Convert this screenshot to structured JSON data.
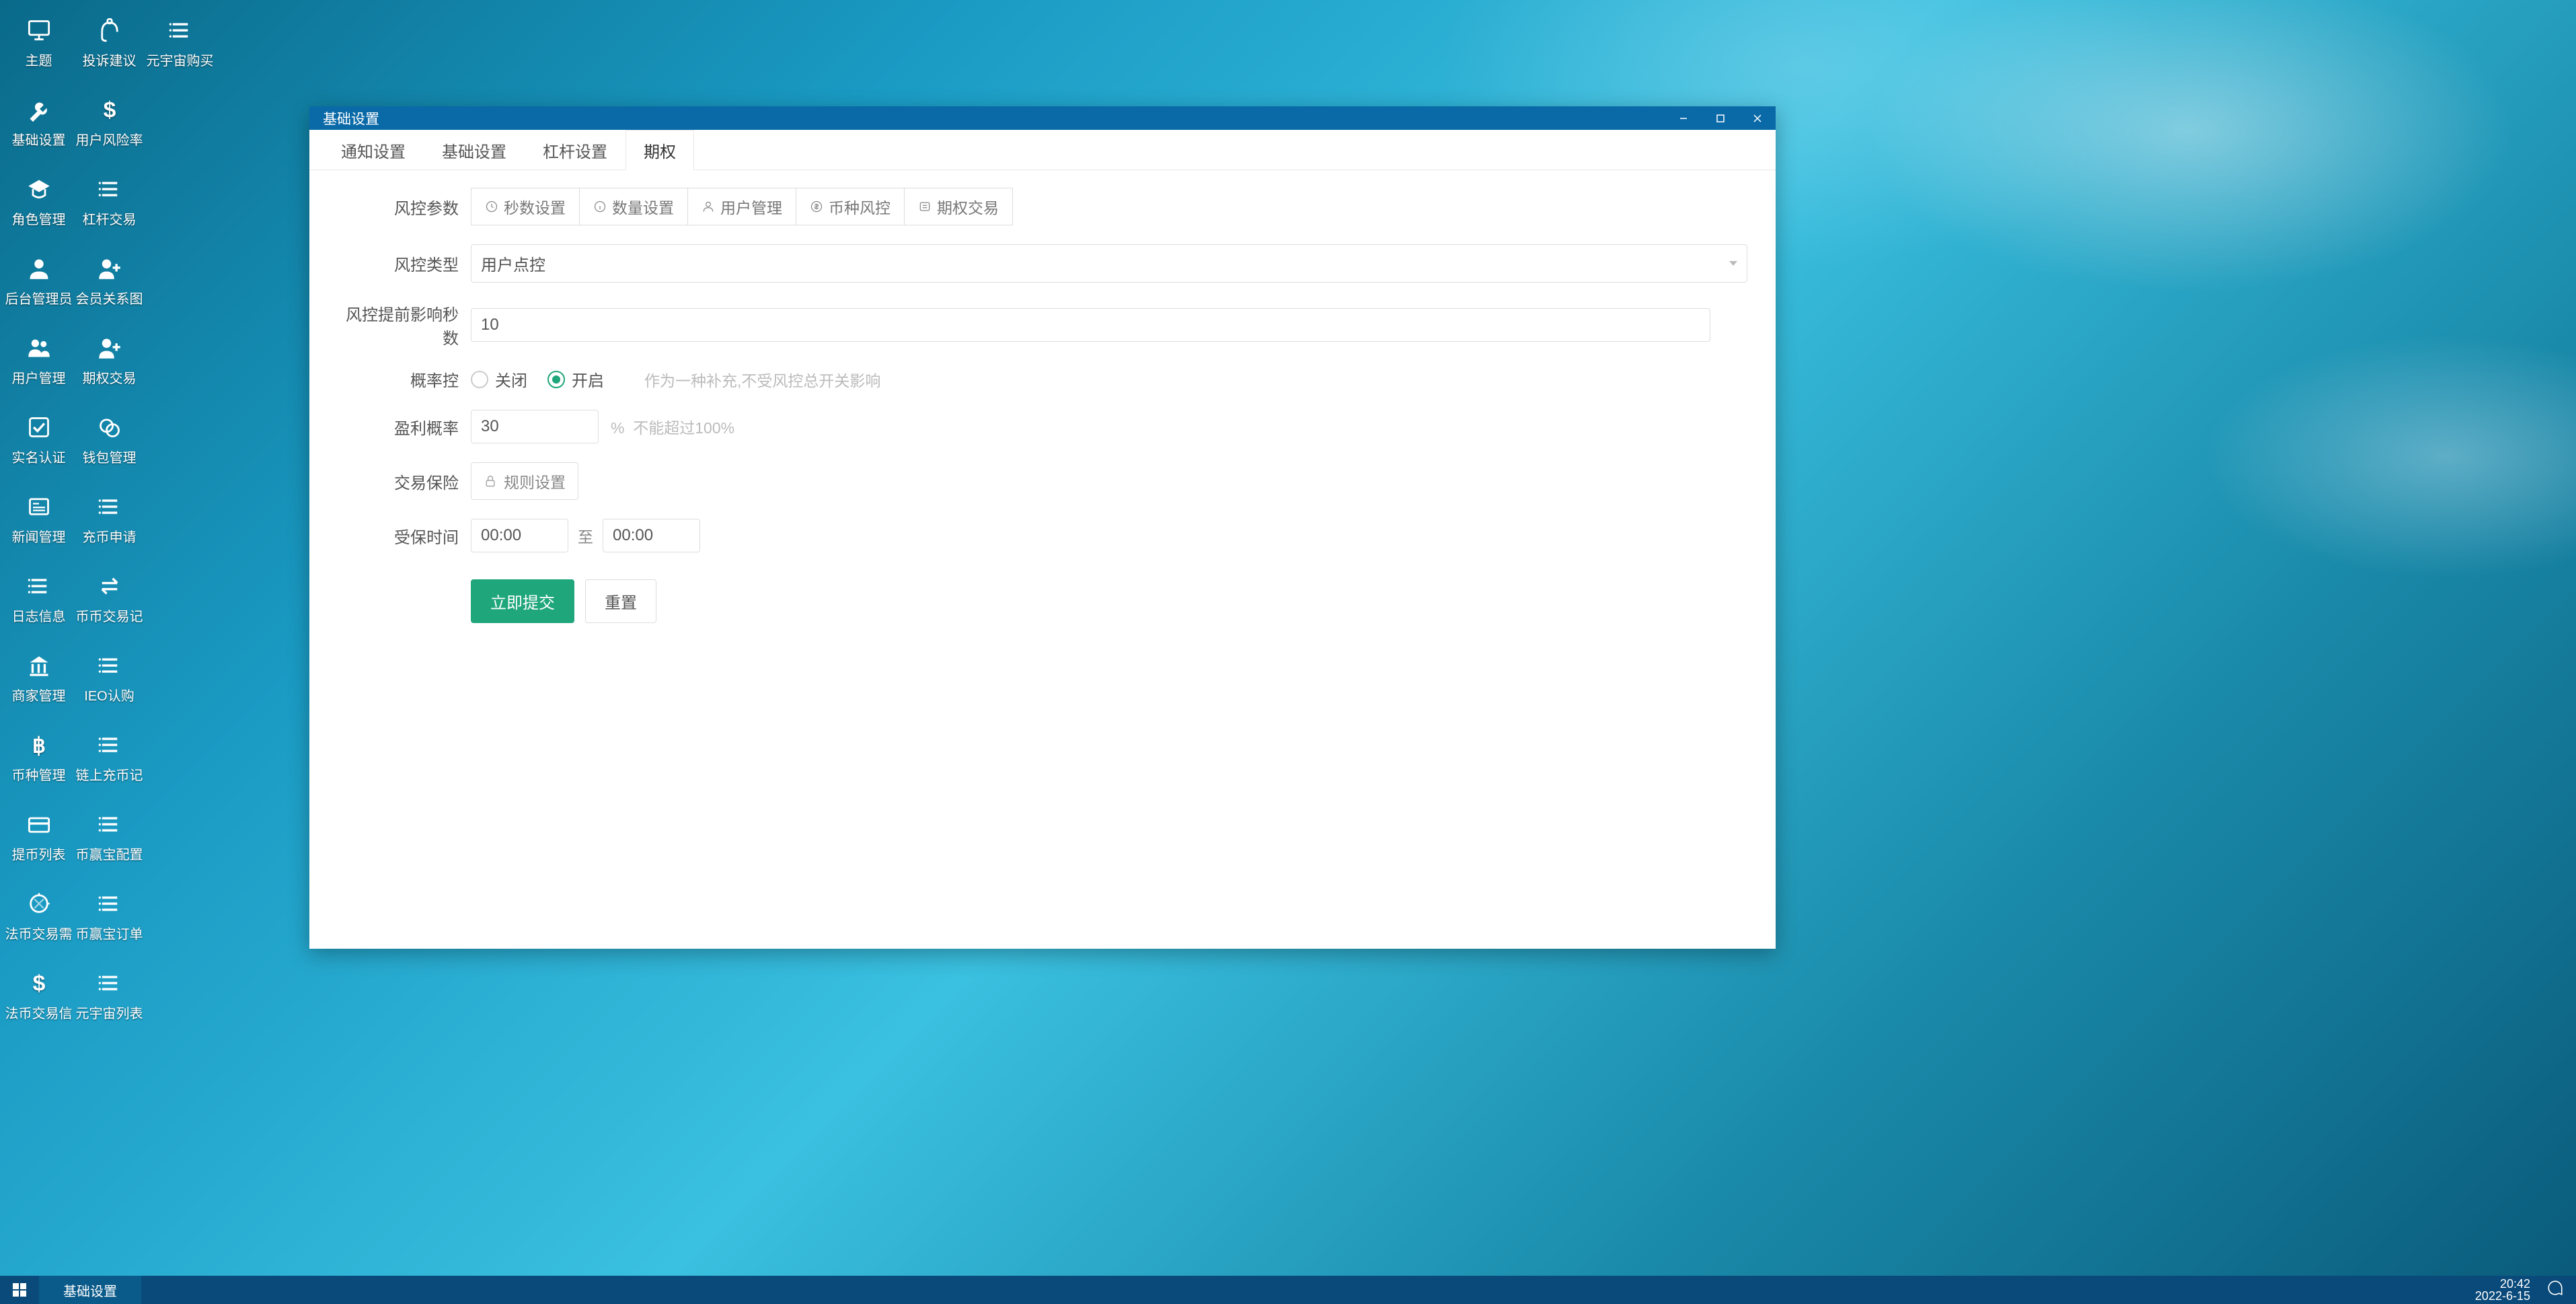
{
  "desktop": {
    "icons": [
      {
        "label": "主题",
        "glyph": "monitor"
      },
      {
        "label": "投诉建议",
        "glyph": "headset"
      },
      {
        "label": "元宇宙购买",
        "glyph": "list"
      },
      {
        "label": "基础设置",
        "glyph": "wrench"
      },
      {
        "label": "用户风险率",
        "glyph": "dollar"
      },
      {
        "label": "",
        "glyph": ""
      },
      {
        "label": "角色管理",
        "glyph": "grad"
      },
      {
        "label": "杠杆交易",
        "glyph": "list"
      },
      {
        "label": "",
        "glyph": ""
      },
      {
        "label": "后台管理员",
        "glyph": "user"
      },
      {
        "label": "会员关系图",
        "glyph": "user-plus"
      },
      {
        "label": "",
        "glyph": ""
      },
      {
        "label": "用户管理",
        "glyph": "users"
      },
      {
        "label": "期权交易",
        "glyph": "user-plus"
      },
      {
        "label": "",
        "glyph": ""
      },
      {
        "label": "实名认证",
        "glyph": "check-badge"
      },
      {
        "label": "钱包管理",
        "glyph": "coins"
      },
      {
        "label": "",
        "glyph": ""
      },
      {
        "label": "新闻管理",
        "glyph": "news"
      },
      {
        "label": "充币申请",
        "glyph": "list"
      },
      {
        "label": "",
        "glyph": ""
      },
      {
        "label": "日志信息",
        "glyph": "list"
      },
      {
        "label": "币币交易记",
        "glyph": "swap"
      },
      {
        "label": "",
        "glyph": ""
      },
      {
        "label": "商家管理",
        "glyph": "bank"
      },
      {
        "label": "IEO认购",
        "glyph": "list"
      },
      {
        "label": "",
        "glyph": ""
      },
      {
        "label": "币种管理",
        "glyph": "bitcoin"
      },
      {
        "label": "链上充币记",
        "glyph": "list"
      },
      {
        "label": "",
        "glyph": ""
      },
      {
        "label": "提币列表",
        "glyph": "card"
      },
      {
        "label": "币赢宝配置",
        "glyph": "list"
      },
      {
        "label": "",
        "glyph": ""
      },
      {
        "label": "法币交易需",
        "glyph": "refresh"
      },
      {
        "label": "币赢宝订单",
        "glyph": "list"
      },
      {
        "label": "",
        "glyph": ""
      },
      {
        "label": "法币交易信",
        "glyph": "dollar"
      },
      {
        "label": "元宇宙列表",
        "glyph": "list"
      },
      {
        "label": "",
        "glyph": ""
      }
    ]
  },
  "window": {
    "title": "基础设置",
    "tabs": [
      "通知设置",
      "基础设置",
      "杠杆设置",
      "期权"
    ],
    "active_tab": 3,
    "form": {
      "params_label": "风控参数",
      "subtabs": [
        {
          "label": "秒数设置",
          "icon": "clock"
        },
        {
          "label": "数量设置",
          "icon": "info"
        },
        {
          "label": "用户管理",
          "icon": "person"
        },
        {
          "label": "币种风控",
          "icon": "dollar-circle"
        },
        {
          "label": "期权交易",
          "icon": "list-circle"
        }
      ],
      "type_label": "风控类型",
      "type_value": "用户点控",
      "seconds_label": "风控提前影响秒数",
      "seconds_value": "10",
      "prob_ctrl_label": "概率控",
      "radio_off": "关闭",
      "radio_on": "开启",
      "prob_hint": "作为一种补充,不受风控总开关影响",
      "profit_prob_label": "盈利概率",
      "profit_prob_value": "30",
      "profit_prob_unit": "%",
      "profit_prob_hint": "不能超过100%",
      "insurance_label": "交易保险",
      "rule_btn": "规则设置",
      "covered_time_label": "受保时间",
      "time_from": "00:00",
      "time_to_label": "至",
      "time_to": "00:00",
      "submit": "立即提交",
      "reset": "重置"
    }
  },
  "taskbar": {
    "task": "基础设置",
    "time": "20:42",
    "date": "2022-6-15"
  }
}
